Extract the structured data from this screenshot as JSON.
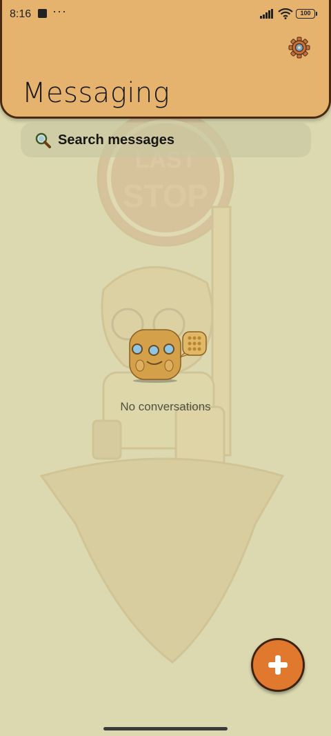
{
  "status_bar": {
    "time": "8:16",
    "overflow": "···",
    "battery": "100",
    "icons": [
      "notification-square-icon",
      "signal-icon",
      "wifi-icon",
      "battery-icon"
    ]
  },
  "header": {
    "title": "Messaging",
    "settings_icon": "gear-icon",
    "background_color": "#e6b36f",
    "border_color": "#4a2a0f"
  },
  "search": {
    "placeholder": "Search messages",
    "icon": "search-icon"
  },
  "empty_state": {
    "message": "No conversations",
    "illustration": "dice-mascot-icon"
  },
  "background": {
    "sign_text": [
      "LAST",
      "STOP"
    ]
  },
  "fab": {
    "icon": "plus-icon",
    "color": "#e0782e"
  }
}
